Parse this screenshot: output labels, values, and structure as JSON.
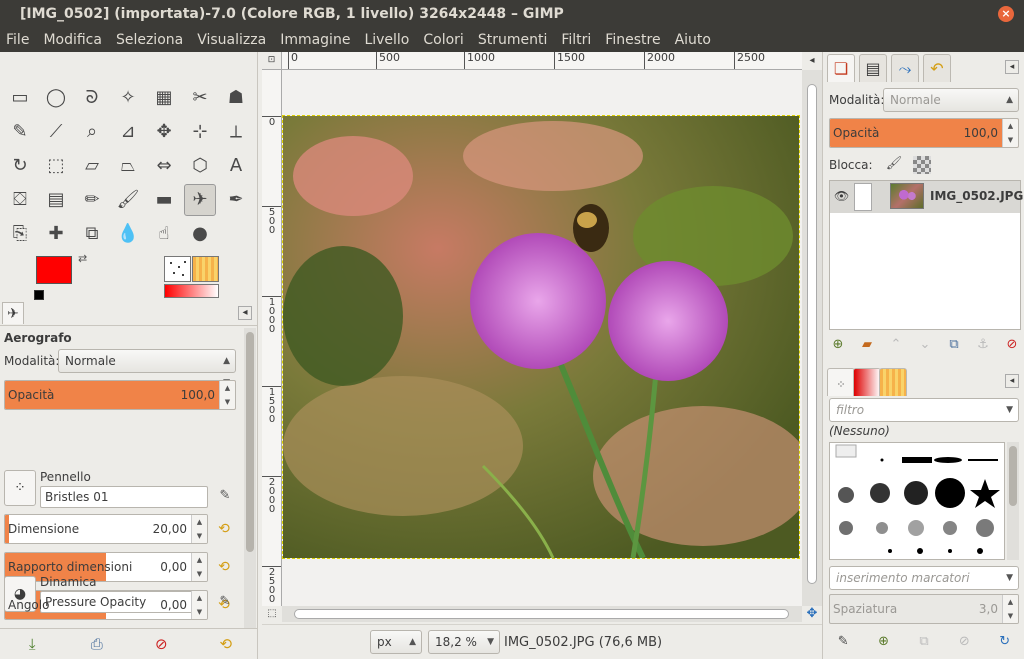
{
  "window": {
    "title": "[IMG_0502] (importata)-7.0 (Colore RGB, 1 livello) 3264x2448 – GIMP",
    "close_glyph": "×"
  },
  "menu": [
    "File",
    "Modifica",
    "Seleziona",
    "Visualizza",
    "Immagine",
    "Livello",
    "Colori",
    "Strumenti",
    "Filtri",
    "Finestre",
    "Aiuto"
  ],
  "tools": [
    {
      "name": "rect-select",
      "glyph": "▭"
    },
    {
      "name": "ellipse-select",
      "glyph": "◯"
    },
    {
      "name": "free-select",
      "glyph": "ᘐ"
    },
    {
      "name": "fuzzy-select",
      "glyph": "✧"
    },
    {
      "name": "select-by-color",
      "glyph": "▦"
    },
    {
      "name": "scissors-select",
      "glyph": "✂"
    },
    {
      "name": "foreground-select",
      "glyph": "☗"
    },
    {
      "name": "paths",
      "glyph": "✎"
    },
    {
      "name": "color-picker",
      "glyph": "⟋"
    },
    {
      "name": "zoom",
      "glyph": "⌕"
    },
    {
      "name": "measure",
      "glyph": "⊿"
    },
    {
      "name": "move",
      "glyph": "✥"
    },
    {
      "name": "align",
      "glyph": "⊹"
    },
    {
      "name": "crop",
      "glyph": "⟂"
    },
    {
      "name": "rotate",
      "glyph": "↻"
    },
    {
      "name": "scale",
      "glyph": "⬚"
    },
    {
      "name": "shear",
      "glyph": "▱"
    },
    {
      "name": "perspective",
      "glyph": "⏢"
    },
    {
      "name": "flip",
      "glyph": "⇔"
    },
    {
      "name": "cage-transform",
      "glyph": "⬡"
    },
    {
      "name": "text",
      "glyph": "A"
    },
    {
      "name": "bucket-fill",
      "glyph": "⛋"
    },
    {
      "name": "blend",
      "glyph": "▤"
    },
    {
      "name": "pencil",
      "glyph": "✏"
    },
    {
      "name": "paintbrush",
      "glyph": "🖌"
    },
    {
      "name": "eraser",
      "glyph": "▬"
    },
    {
      "name": "airbrush",
      "glyph": "✈"
    },
    {
      "name": "ink",
      "glyph": "✒"
    },
    {
      "name": "clone",
      "glyph": "⎘"
    },
    {
      "name": "heal",
      "glyph": "✚"
    },
    {
      "name": "perspective-clone",
      "glyph": "⧉"
    },
    {
      "name": "blur-sharpen",
      "glyph": "💧"
    },
    {
      "name": "smudge",
      "glyph": "☝"
    },
    {
      "name": "dodge-burn",
      "glyph": "●"
    }
  ],
  "active_tool_index": 26,
  "colors": {
    "foreground": "#ff0000",
    "background": "#ffffff",
    "accent": "#f08348"
  },
  "tool_options": {
    "title": "Aerografo",
    "mode_label": "Modalità:",
    "mode_value": "Normale",
    "opacity_label": "Opacità",
    "opacity_value": "100,0",
    "opacity_fraction": 1.0,
    "brush_label": "Pennello",
    "brush_value": "Bristles 01",
    "size_label": "Dimensione",
    "size_value": "20,00",
    "size_fraction": 0.02,
    "ratio_label": "Rapporto dimensioni",
    "ratio_value": "0,00",
    "ratio_fraction": 0.5,
    "angle_label": "Angolo",
    "angle_value": "0,00",
    "angle_fraction": 0.5,
    "dynamics_label": "Dinamica",
    "dynamics_value": "Pressure Opacity"
  },
  "ruler": {
    "h_marks": [
      {
        "label": "0"
      },
      {
        "label": "500"
      },
      {
        "label": "1000"
      },
      {
        "label": "1500"
      },
      {
        "label": "2000"
      },
      {
        "label": "2500"
      }
    ],
    "v_marks": [
      "0",
      "5\n0\n0",
      "1\n0\n0\n0",
      "1\n5\n0\n0",
      "2\n0\n0\n0",
      "2\n5\n0\n0"
    ]
  },
  "status": {
    "unit": "px",
    "zoom": "18,2 %",
    "info": "IMG_0502.JPG (76,6 MB)"
  },
  "layers": {
    "mode_label": "Modalità:",
    "mode_value": "Normale",
    "opacity_label": "Opacità",
    "opacity_value": "100,0",
    "opacity_fraction": 1.0,
    "lock_label": "Blocca:",
    "layer_name": "IMG_0502.JPG"
  },
  "brushes": {
    "filter_placeholder": "filtro",
    "tag_label": "(Nessuno)",
    "insert_tags_placeholder": "inserimento marcatori",
    "spacing_label": "Spaziatura",
    "spacing_value": "3,0"
  }
}
